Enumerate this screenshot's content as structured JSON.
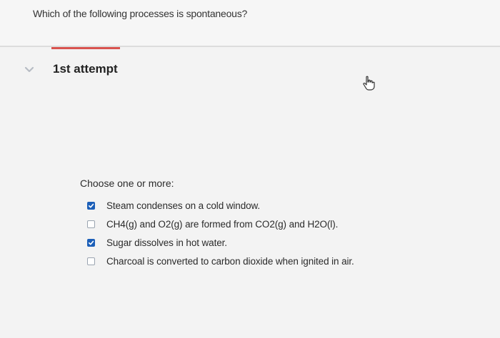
{
  "question": {
    "text": "Which of the following processes is spontaneous?"
  },
  "attempt": {
    "label": "1st attempt"
  },
  "prompt": {
    "label": "Choose one or more:"
  },
  "options": [
    {
      "text": "Steam condenses on a cold window.",
      "checked": true
    },
    {
      "text": "CH4(g) and O2(g) are formed from CO2(g) and H2O(l).",
      "checked": false
    },
    {
      "text": "Sugar dissolves in hot water.",
      "checked": true
    },
    {
      "text": "Charcoal is converted to carbon dioxide when ignited in air.",
      "checked": false
    }
  ],
  "icons": {
    "chevron": "chevron-down-icon",
    "cursor": "hand-pointer-icon",
    "check": "checkmark-icon"
  },
  "colors": {
    "accent_underline": "#d9534f",
    "checkbox_checked": "#1c5fb8",
    "background": "#f3f3f3"
  }
}
